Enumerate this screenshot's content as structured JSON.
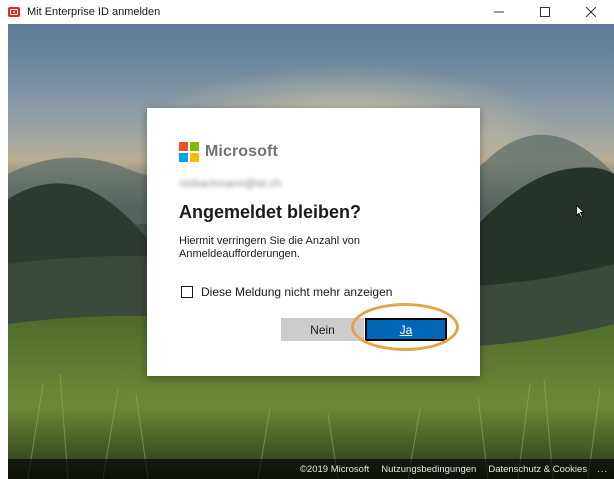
{
  "window": {
    "title": "Mit Enterprise ID anmelden",
    "controls": {
      "minimize": "minimize-icon",
      "maximize": "maximize-icon",
      "close": "close-icon"
    }
  },
  "dialog": {
    "brand": "Microsoft",
    "email": "nicbachmann@ist.ch",
    "heading": "Angemeldet bleiben?",
    "description": "Hiermit verringern Sie die Anzahl von Anmeldeaufforderungen.",
    "checkbox_label": "Diese Meldung nicht mehr anzeigen",
    "checkbox_checked": false,
    "no_button": "Nein",
    "yes_button": "Ja"
  },
  "footer": {
    "copyright": "©2019 Microsoft",
    "terms": "Nutzungsbedingungen",
    "privacy": "Datenschutz & Cookies",
    "more": "..."
  },
  "colors": {
    "primary_button": "#0067b8",
    "secondary_button": "#cccccc",
    "highlight_ring": "#e8a24a",
    "app_icon": "#e0281c"
  }
}
